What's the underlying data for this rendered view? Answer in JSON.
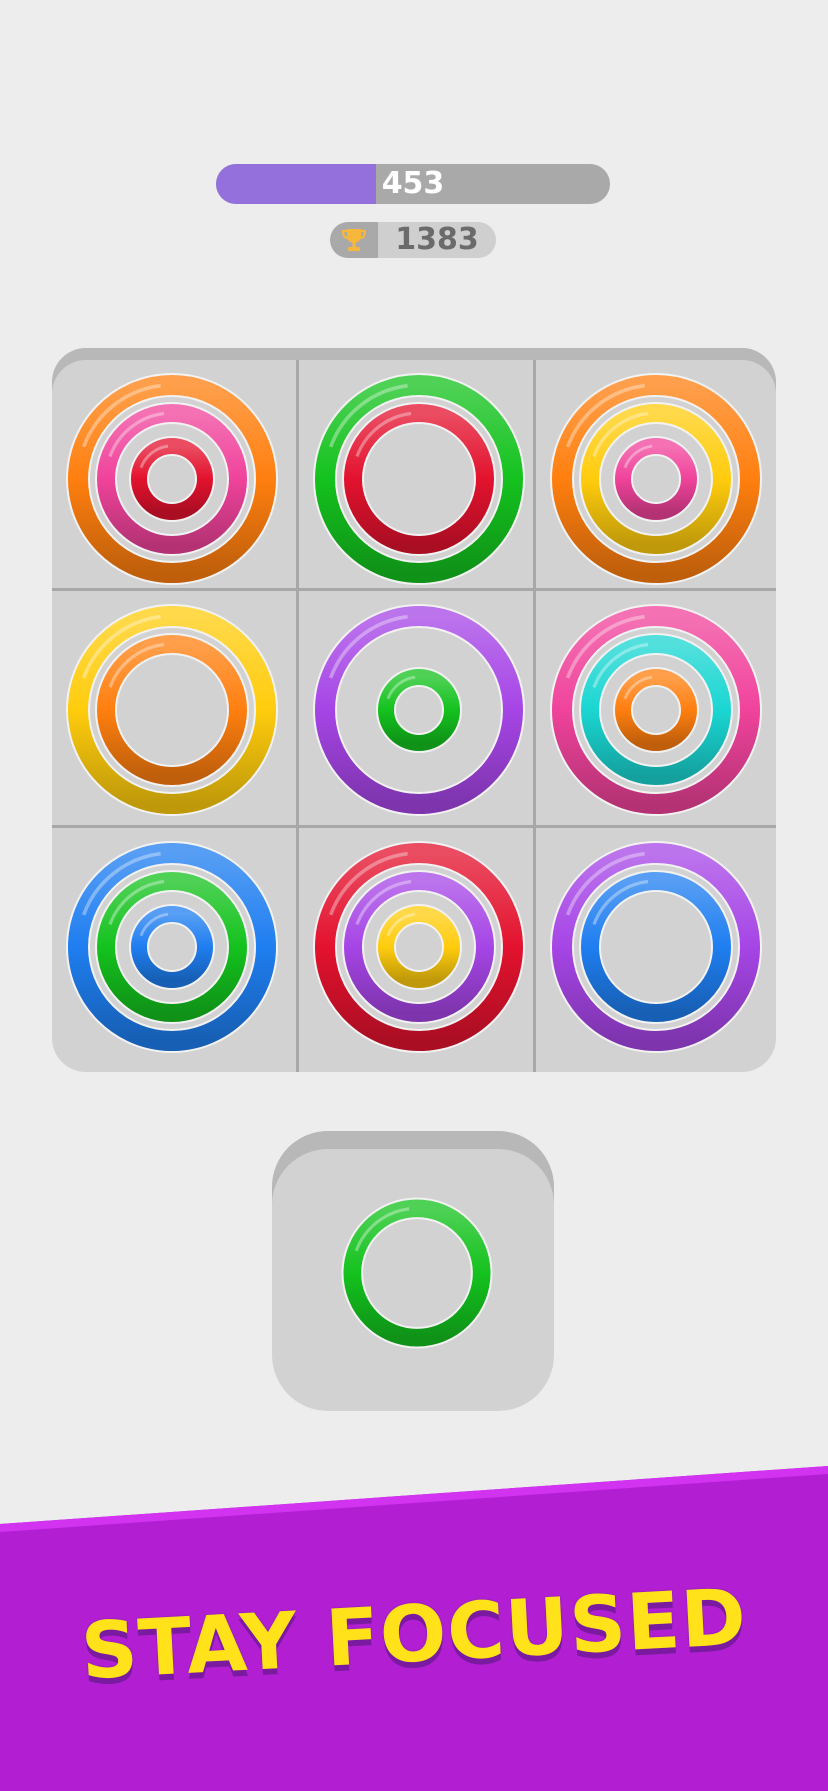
{
  "progress": {
    "value_label": "453",
    "fraction": 0.405,
    "fill_color": "#9470dc"
  },
  "best_score": {
    "value": "1383",
    "icon": "trophy-icon"
  },
  "colors": {
    "orange": "#ff7f0f",
    "pink": "#f0439b",
    "red": "#e3122e",
    "green": "#14c21e",
    "yellow": "#ffcc0d",
    "purple": "#a645e6",
    "cyan": "#1ad6d2",
    "blue": "#1f7ef0"
  },
  "board": {
    "rows": 3,
    "cols": 3,
    "cells": [
      {
        "large": "orange",
        "medium": "pink",
        "small": "red"
      },
      {
        "large": "green",
        "medium": "red",
        "small": null
      },
      {
        "large": "orange",
        "medium": "yellow",
        "small": "pink"
      },
      {
        "large": "yellow",
        "medium": "orange",
        "small": null
      },
      {
        "large": "purple",
        "medium": null,
        "small": "green"
      },
      {
        "large": "pink",
        "medium": "cyan",
        "small": "orange"
      },
      {
        "large": "blue",
        "medium": "green",
        "small": "blue"
      },
      {
        "large": "red",
        "medium": "purple",
        "small": "yellow"
      },
      {
        "large": "purple",
        "medium": "blue",
        "small": null
      }
    ]
  },
  "next_piece": {
    "large": null,
    "medium": "green",
    "small": null
  },
  "banner": {
    "text": "STAY FOCUSED",
    "background": "#b21fd3",
    "text_color": "#ffe21a"
  }
}
